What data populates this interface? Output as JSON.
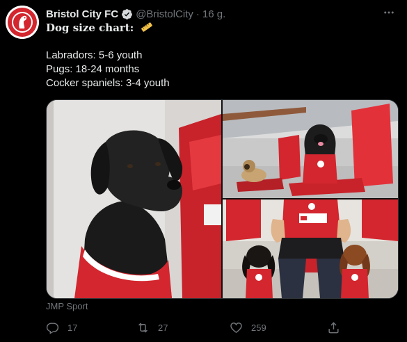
{
  "tweet": {
    "author_name": "Bristol City FC",
    "handle": "@BristolCity",
    "separator": "·",
    "time": "16 g.",
    "lines": [
      "Dog size chart:",
      "",
      "Labradors: 5-6 youth",
      "Pugs: 18-24 months",
      "Cocker spaniels: 3-4 youth"
    ],
    "media_source": "JMP Sport"
  },
  "actions": {
    "replies": "17",
    "retweets": "27",
    "likes": "259"
  },
  "icons": {
    "avatar": "bristol-city-crest-icon",
    "verified": "verified-badge-icon",
    "more": "more-icon",
    "ruler": "ruler-icon",
    "reply": "reply-icon",
    "retweet": "retweet-icon",
    "like": "heart-icon",
    "share": "share-icon"
  },
  "colors": {
    "background": "#000000",
    "text": "#e7e9ea",
    "muted": "#71767b",
    "club_red": "#d3262e"
  }
}
